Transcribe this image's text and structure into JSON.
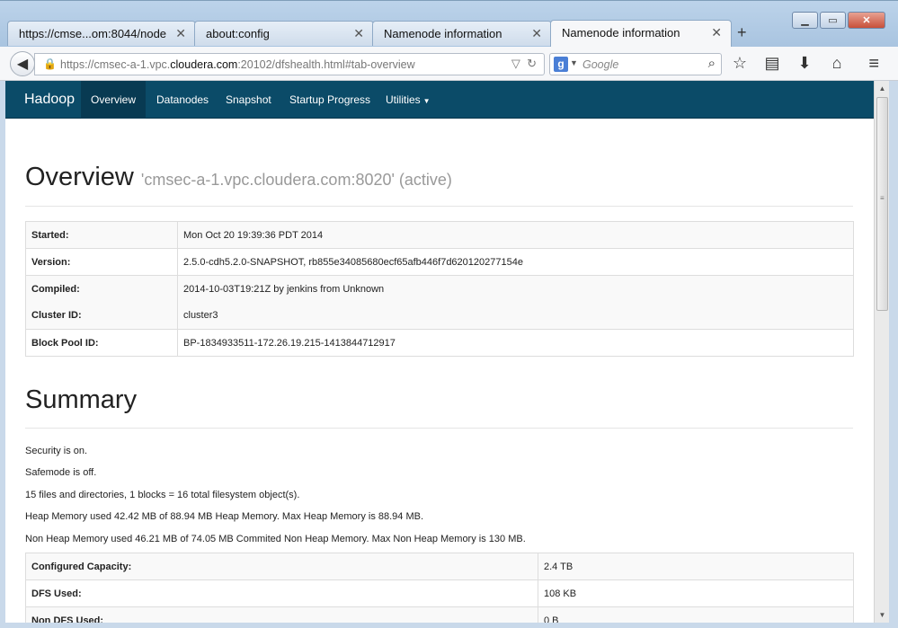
{
  "browser": {
    "tabs": [
      {
        "title": "https://cmse...om:8044/node",
        "active": false
      },
      {
        "title": "about:config",
        "active": false
      },
      {
        "title": "Namenode information",
        "active": false
      },
      {
        "title": "Namenode information",
        "active": true
      }
    ],
    "new_tab": "+",
    "url_prefix": "https://cmsec-a-1.vpc.",
    "url_domain": "cloudera.com",
    "url_suffix": ":20102/dfshealth.html#tab-overview",
    "search_engine_letter": "g",
    "search_placeholder": "Google",
    "window_controls": {
      "minimize": "▁",
      "maximize": "▭",
      "close": "✕"
    }
  },
  "app": {
    "brand": "Hadoop",
    "nav": [
      {
        "label": "Overview",
        "active": true
      },
      {
        "label": "Datanodes",
        "active": false
      },
      {
        "label": "Snapshot",
        "active": false
      },
      {
        "label": "Startup Progress",
        "active": false
      },
      {
        "label": "Utilities",
        "active": false,
        "dropdown": true
      }
    ]
  },
  "overview": {
    "heading": "Overview",
    "subheading": "'cmsec-a-1.vpc.cloudera.com:8020' (active)",
    "rows": [
      {
        "key": "Started:",
        "value": "Mon Oct 20 19:39:36 PDT 2014"
      },
      {
        "key": "Version:",
        "value": "2.5.0-cdh5.2.0-SNAPSHOT, rb855e34085680ecf65afb446f7d620120277154e"
      },
      {
        "key": "Compiled:",
        "value": "2014-10-03T19:21Z by jenkins from Unknown"
      },
      {
        "key": "Cluster ID:",
        "value": "cluster3"
      },
      {
        "key": "Block Pool ID:",
        "value": "BP-1834933511-172.26.19.215-1413844712917"
      }
    ]
  },
  "summary": {
    "heading": "Summary",
    "lines": [
      "Security is on.",
      "Safemode is off.",
      "15 files and directories, 1 blocks = 16 total filesystem object(s).",
      "Heap Memory used 42.42 MB of 88.94 MB Heap Memory. Max Heap Memory is 88.94 MB.",
      "Non Heap Memory used 46.21 MB of 74.05 MB Commited Non Heap Memory. Max Non Heap Memory is 130 MB."
    ],
    "rows": [
      {
        "key": "Configured Capacity:",
        "value": "2.4 TB"
      },
      {
        "key": "DFS Used:",
        "value": "108 KB"
      },
      {
        "key": "Non DFS Used:",
        "value": "0 B"
      }
    ]
  },
  "icons": {
    "back": "back-arrow-icon",
    "lock": "lock-icon",
    "search": "magnifier-icon",
    "bookmark": "star-icon",
    "reading_list": "list-icon",
    "downloads": "download-icon",
    "home": "home-icon",
    "menu": "hamburger-icon"
  }
}
